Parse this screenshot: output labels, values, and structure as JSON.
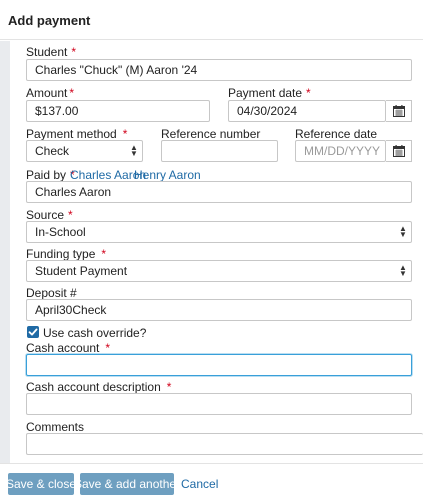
{
  "header": {
    "title": "Add payment"
  },
  "student": {
    "label": "Student",
    "value": "Charles \"Chuck\" (M) Aaron '24"
  },
  "amount": {
    "label": "Amount",
    "value": "$137.00"
  },
  "payment_date": {
    "label": "Payment date",
    "value": "04/30/2024"
  },
  "payment_method": {
    "label": "Payment method",
    "value": "Check"
  },
  "reference_number": {
    "label": "Reference number",
    "value": ""
  },
  "reference_date": {
    "label": "Reference date",
    "placeholder": "MM/DD/YYYY"
  },
  "paid_by": {
    "label": "Paid by",
    "links": [
      "Charles Aaron",
      "Henry Aaron"
    ],
    "value": "Charles Aaron"
  },
  "source": {
    "label": "Source",
    "value": "In-School"
  },
  "funding_type": {
    "label": "Funding type",
    "value": "Student Payment"
  },
  "deposit": {
    "label": "Deposit #",
    "value": "April30Check"
  },
  "cash_override": {
    "label": "Use cash override?",
    "checked": true
  },
  "cash_account": {
    "label": "Cash account",
    "value": ""
  },
  "cash_account_description": {
    "label": "Cash account description",
    "value": ""
  },
  "comments": {
    "label": "Comments",
    "value": ""
  },
  "footer": {
    "save_close": "Save & close",
    "save_add_another": "Save & add another",
    "cancel": "Cancel"
  },
  "required_mark": "*",
  "icons": {
    "calendar": "calendar-icon",
    "select": "chevron-updown-icon",
    "check": "checkmark-icon"
  },
  "colors": {
    "accent": "#1f6aa5",
    "required": "#d0021b",
    "button": "#6e9fc0",
    "focus": "#39a0d9"
  }
}
